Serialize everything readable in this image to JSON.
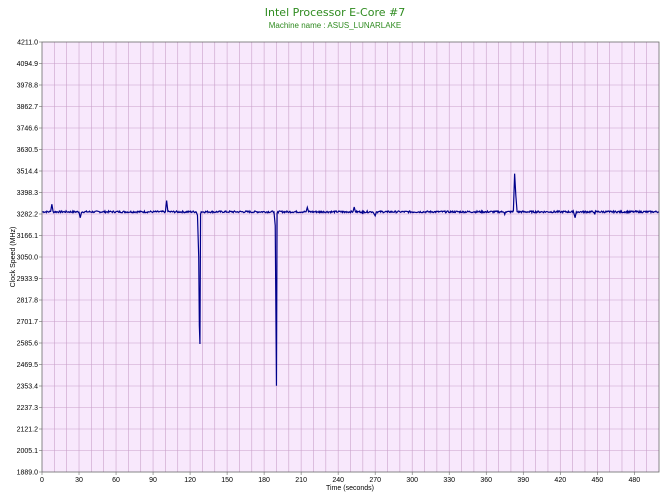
{
  "chart_data": {
    "type": "line",
    "title": "Intel Processor E-Core #7",
    "subtitle": "Machine name : ASUS_LUNARLAKE",
    "xlabel": "Time (seconds)",
    "ylabel": "Clock Speed (MHz)",
    "xlim": [
      0,
      500
    ],
    "ylim": [
      1889.0,
      4211.0
    ],
    "x_ticks": [
      0,
      30,
      60,
      90,
      120,
      150,
      180,
      210,
      240,
      270,
      300,
      330,
      360,
      390,
      420,
      450,
      480
    ],
    "y_ticks": [
      "4211.0",
      "4094.9",
      "3978.8",
      "3862.7",
      "3746.6",
      "3630.5",
      "3514.4",
      "3398.3",
      "3282.2",
      "3166.1",
      "3050.0",
      "2933.9",
      "2817.8",
      "2701.7",
      "2585.6",
      "2469.5",
      "2353.4",
      "2237.3",
      "2121.2",
      "2005.1",
      "1889.0"
    ],
    "grid": true,
    "legend": "none",
    "series": [
      {
        "color": "#00008b",
        "baseline": 3294,
        "points": [
          [
            0,
            3292
          ],
          [
            7,
            3296
          ],
          [
            8,
            3335
          ],
          [
            9,
            3295
          ],
          [
            20,
            3294
          ],
          [
            30,
            3292
          ],
          [
            31,
            3262
          ],
          [
            32,
            3291
          ],
          [
            42,
            3293
          ],
          [
            55,
            3295
          ],
          [
            62,
            3292
          ],
          [
            70,
            3290
          ],
          [
            80,
            3294
          ],
          [
            90,
            3292
          ],
          [
            100,
            3294
          ],
          [
            101,
            3355
          ],
          [
            102,
            3296
          ],
          [
            110,
            3290
          ],
          [
            115,
            3290
          ],
          [
            125,
            3293
          ],
          [
            126,
            3275
          ],
          [
            127,
            3050
          ],
          [
            127.5,
            2680
          ],
          [
            128,
            2580
          ],
          [
            128.5,
            3282
          ],
          [
            129,
            3294
          ],
          [
            140,
            3290
          ],
          [
            150,
            3292
          ],
          [
            160,
            3294
          ],
          [
            170,
            3290
          ],
          [
            180,
            3295
          ],
          [
            188,
            3293
          ],
          [
            189,
            3220
          ],
          [
            190,
            2355
          ],
          [
            190.5,
            3286
          ],
          [
            191,
            3294
          ],
          [
            200,
            3290
          ],
          [
            210,
            3292
          ],
          [
            214,
            3294
          ],
          [
            215,
            3318
          ],
          [
            216,
            3294
          ],
          [
            225,
            3290
          ],
          [
            235,
            3292
          ],
          [
            245,
            3290
          ],
          [
            252,
            3294
          ],
          [
            253,
            3320
          ],
          [
            254,
            3294
          ],
          [
            260,
            3282
          ],
          [
            266,
            3294
          ],
          [
            270,
            3272
          ],
          [
            271,
            3294
          ],
          [
            280,
            3292
          ],
          [
            290,
            3294
          ],
          [
            300,
            3290
          ],
          [
            310,
            3292
          ],
          [
            320,
            3294
          ],
          [
            330,
            3290
          ],
          [
            340,
            3292
          ],
          [
            350,
            3294
          ],
          [
            360,
            3290
          ],
          [
            374,
            3293
          ],
          [
            375,
            3280
          ],
          [
            376,
            3294
          ],
          [
            382,
            3300
          ],
          [
            383,
            3500
          ],
          [
            384,
            3380
          ],
          [
            385,
            3295
          ],
          [
            395,
            3292
          ],
          [
            410,
            3294
          ],
          [
            420,
            3290
          ],
          [
            430,
            3292
          ],
          [
            432,
            3262
          ],
          [
            433,
            3294
          ],
          [
            440,
            3290
          ],
          [
            448,
            3280
          ],
          [
            449,
            3294
          ],
          [
            460,
            3292
          ],
          [
            470,
            3290
          ],
          [
            480,
            3294
          ],
          [
            490,
            3292
          ],
          [
            500,
            3294
          ]
        ]
      }
    ]
  },
  "colors": {
    "plot_background": "#f8e8fc",
    "grid": "#c9a0c9",
    "title": "#2e8b1f",
    "series": "#00008b"
  }
}
